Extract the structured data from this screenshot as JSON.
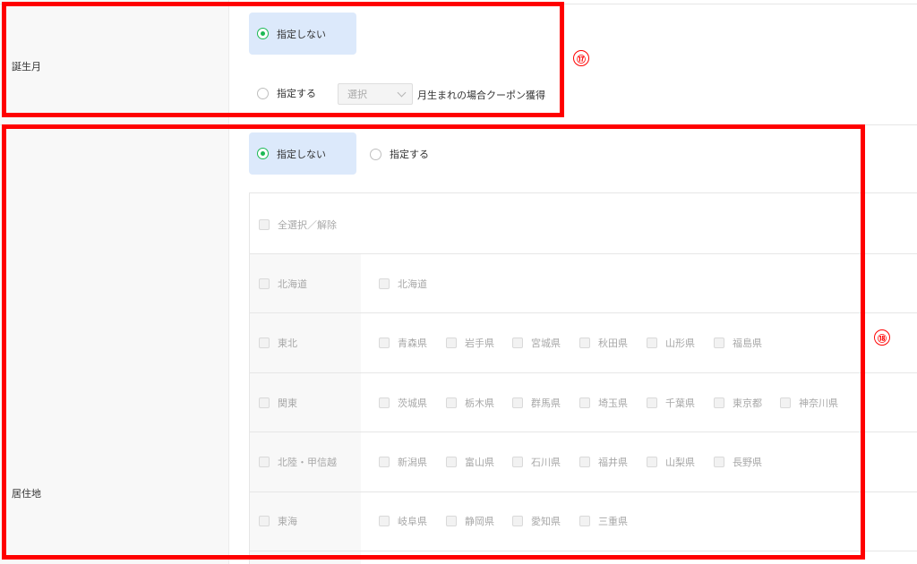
{
  "birth_month": {
    "label": "誕生月",
    "option_unspecified": "指定しない",
    "option_specified": "指定する",
    "select_value": "選択",
    "suffix_text": "月生まれの場合クーポン獲得",
    "selected": "unspecified"
  },
  "residence": {
    "label": "居住地",
    "option_unspecified": "指定しない",
    "option_specified": "指定する",
    "selected": "unspecified",
    "select_all_label": "全選択／解除",
    "regions": [
      {
        "name": "北海道",
        "prefectures": [
          "北海道"
        ]
      },
      {
        "name": "東北",
        "prefectures": [
          "青森県",
          "岩手県",
          "宮城県",
          "秋田県",
          "山形県",
          "福島県"
        ]
      },
      {
        "name": "関東",
        "prefectures": [
          "茨城県",
          "栃木県",
          "群馬県",
          "埼玉県",
          "千葉県",
          "東京都",
          "神奈川県"
        ]
      },
      {
        "name": "北陸・甲信越",
        "prefectures": [
          "新潟県",
          "富山県",
          "石川県",
          "福井県",
          "山梨県",
          "長野県"
        ]
      },
      {
        "name": "東海",
        "prefectures": [
          "岐阜県",
          "静岡県",
          "愛知県",
          "三重県"
        ]
      }
    ]
  },
  "annotations": [
    {
      "number": "17",
      "symbol": "⑰"
    },
    {
      "number": "18",
      "symbol": "⑱"
    }
  ],
  "colors": {
    "annotation_red": "#ff0000",
    "selected_bg": "#dce9fb",
    "radio_green": "#1db954"
  }
}
